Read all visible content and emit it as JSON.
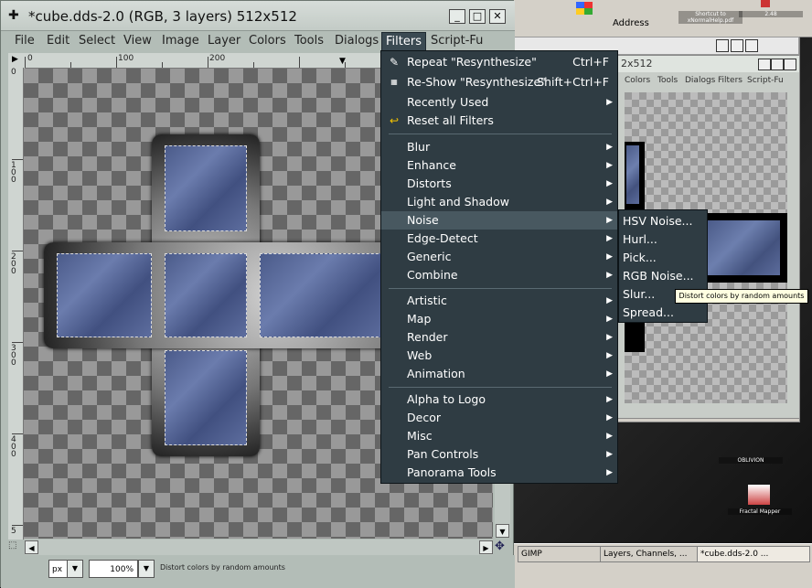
{
  "window": {
    "title": "*cube.dds-2.0 (RGB, 3 layers) 512x512",
    "min_glyph": "_",
    "max_glyph": "□",
    "close_glyph": "✕"
  },
  "menubar": {
    "items": [
      "File",
      "Edit",
      "Select",
      "View",
      "Image",
      "Layer",
      "Colors",
      "Tools",
      "Dialogs",
      "Filters",
      "Script-Fu"
    ]
  },
  "rulers": {
    "top": [
      "0",
      "100",
      "200"
    ],
    "left": [
      "0",
      "1\n0\n0",
      "2\n0\n0",
      "3\n0\n0",
      "4\n0\n0",
      "5"
    ]
  },
  "statusbar": {
    "unit": "px",
    "zoom": "100%",
    "message": "Distort colors by random amounts"
  },
  "filters_menu": {
    "items": [
      {
        "label": "Repeat \"Resynthesize\"",
        "accel": "Ctrl+F"
      },
      {
        "label": "Re-Show \"Resynthesize\"",
        "accel": "Shift+Ctrl+F"
      },
      {
        "label": "Recently Used"
      },
      {
        "label": "Reset all Filters"
      },
      {
        "label": "Blur"
      },
      {
        "label": "Enhance"
      },
      {
        "label": "Distorts"
      },
      {
        "label": "Light and Shadow"
      },
      {
        "label": "Noise"
      },
      {
        "label": "Edge-Detect"
      },
      {
        "label": "Generic"
      },
      {
        "label": "Combine"
      },
      {
        "label": "Artistic"
      },
      {
        "label": "Map"
      },
      {
        "label": "Render"
      },
      {
        "label": "Web"
      },
      {
        "label": "Animation"
      },
      {
        "label": "Alpha to Logo"
      },
      {
        "label": "Decor"
      },
      {
        "label": "Misc"
      },
      {
        "label": "Pan Controls"
      },
      {
        "label": "Panorama Tools"
      }
    ]
  },
  "noise_menu": {
    "items": [
      "HSV Noise...",
      "Hurl...",
      "Pick...",
      "RGB Noise...",
      "Slur...",
      "Spread..."
    ]
  },
  "tooltip": "Distort colors by random amounts",
  "background_window": {
    "title_fragment": "2x512",
    "menus": [
      "Colors",
      "Tools",
      "Dialogs",
      "Filters",
      "Script-Fu"
    ]
  },
  "explorer": {
    "address_label": "Address"
  },
  "desktop_icons": {
    "shortcut": "Shortcut to\nxNormalHelp.pdf",
    "version": "2.48",
    "oblivion": "OBLIVION",
    "fractal": "Fractal Mapper"
  },
  "taskbar": {
    "buttons": [
      "GIMP",
      "Layers, Channels, ...",
      "*cube.dds-2.0 ..."
    ]
  },
  "colors": {
    "menu_bg": "#2f3c43",
    "menu_highlight": "#485860",
    "window_bg": "#b3bdb7",
    "tile_blue": "#5d6d9e"
  }
}
